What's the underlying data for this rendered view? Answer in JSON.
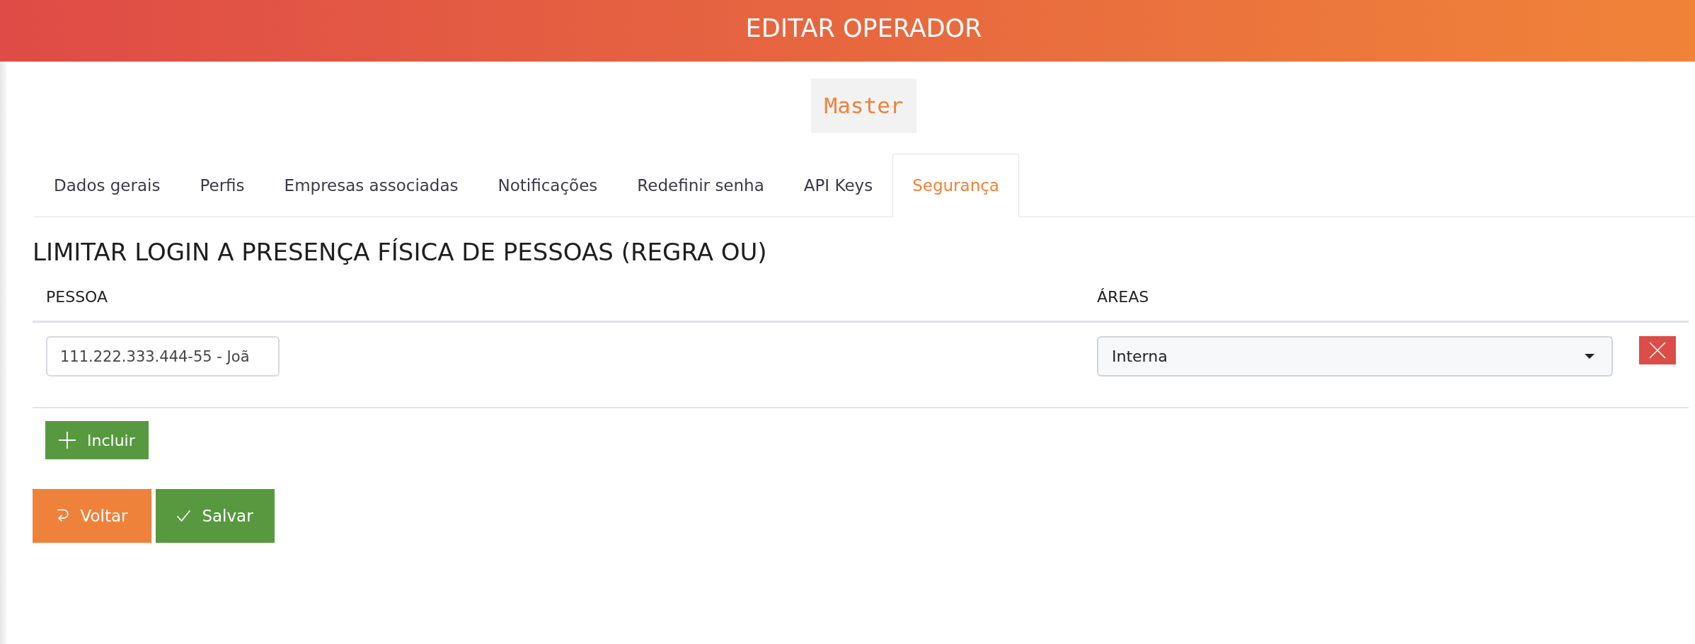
{
  "header": {
    "title": "EDITAR OPERADOR"
  },
  "profile_badge": {
    "text": "Master"
  },
  "tabs": [
    {
      "label": "Dados gerais",
      "selected": false
    },
    {
      "label": "Perfis",
      "selected": false
    },
    {
      "label": "Empresas associadas",
      "selected": false
    },
    {
      "label": "Notificações",
      "selected": false
    },
    {
      "label": "Redefinir senha",
      "selected": false
    },
    {
      "label": "API Keys",
      "selected": false
    },
    {
      "label": "Segurança",
      "selected": true
    }
  ],
  "rule_section": {
    "title": "LIMITAR LOGIN A PRESENÇA FÍSICA DE PESSOAS (REGRA OU)",
    "table": {
      "columns": [
        "PESSOA",
        "ÁREAS"
      ],
      "rows": [
        {
          "person": "111.222.333.444-55 - Joã",
          "area": "Interna"
        }
      ]
    },
    "add_button": {
      "label": "Incluir"
    }
  },
  "actions": [
    {
      "kind": "back",
      "label": "Voltar"
    },
    {
      "kind": "save",
      "label": "Salvar"
    }
  ]
}
